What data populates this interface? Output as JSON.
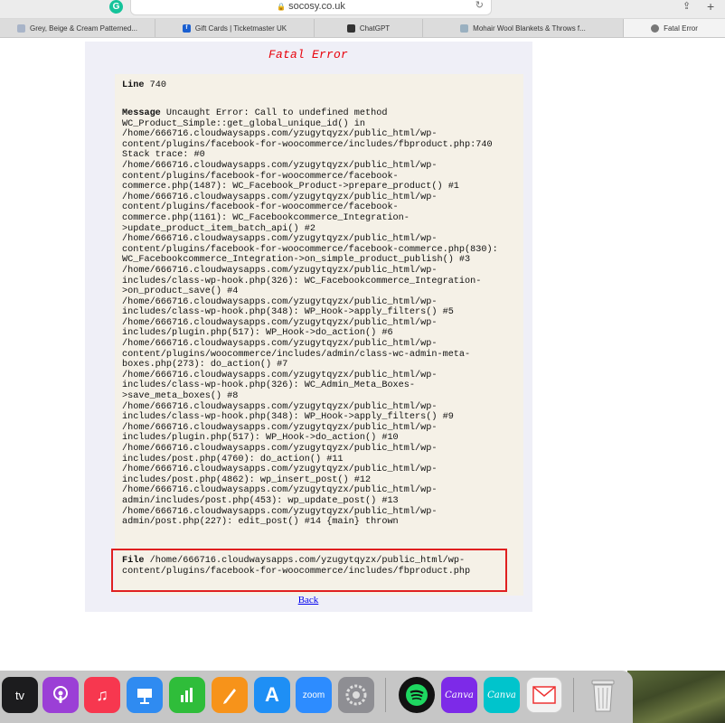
{
  "browser": {
    "url": "socosy.co.uk",
    "tabs": [
      {
        "label": "Grey, Beige & Cream Patterned...",
        "favicon_color": "#a8b4c8",
        "active": false
      },
      {
        "label": "Gift Cards | Ticketmaster UK",
        "favicon_color": "#1a5fd0",
        "favicon_glyph": "f",
        "active": false
      },
      {
        "label": "ChatGPT",
        "favicon_color": "#333333",
        "active": false
      },
      {
        "label": "Mohair Wool Blankets & Throws f...",
        "favicon_color": "#9ab0c0",
        "active": false
      },
      {
        "label": "Fatal Error",
        "favicon_color": "#777777",
        "active": true
      }
    ]
  },
  "page": {
    "title": "Fatal Error",
    "line_label": "Line",
    "line_value": "740",
    "message_label": "Message",
    "message_text": "Uncaught Error: Call to undefined method\nWC_Product_Simple::get_global_unique_id() in\n/home/666716.cloudwaysapps.com/yzugytqyzx/public_html/wp-\ncontent/plugins/facebook-for-woocommerce/includes/fbproduct.php:740\nStack trace: #0\n/home/666716.cloudwaysapps.com/yzugytqyzx/public_html/wp-\ncontent/plugins/facebook-for-woocommerce/facebook-\ncommerce.php(1487): WC_Facebook_Product->prepare_product() #1\n/home/666716.cloudwaysapps.com/yzugytqyzx/public_html/wp-\ncontent/plugins/facebook-for-woocommerce/facebook-\ncommerce.php(1161): WC_Facebookcommerce_Integration-\n>update_product_item_batch_api() #2\n/home/666716.cloudwaysapps.com/yzugytqyzx/public_html/wp-\ncontent/plugins/facebook-for-woocommerce/facebook-commerce.php(830):\nWC_Facebookcommerce_Integration->on_simple_product_publish() #3\n/home/666716.cloudwaysapps.com/yzugytqyzx/public_html/wp-\nincludes/class-wp-hook.php(326): WC_Facebookcommerce_Integration-\n>on_product_save() #4\n/home/666716.cloudwaysapps.com/yzugytqyzx/public_html/wp-\nincludes/class-wp-hook.php(348): WP_Hook->apply_filters() #5\n/home/666716.cloudwaysapps.com/yzugytqyzx/public_html/wp-\nincludes/plugin.php(517): WP_Hook->do_action() #6\n/home/666716.cloudwaysapps.com/yzugytqyzx/public_html/wp-\ncontent/plugins/woocommerce/includes/admin/class-wc-admin-meta-\nboxes.php(273): do_action() #7\n/home/666716.cloudwaysapps.com/yzugytqyzx/public_html/wp-\nincludes/class-wp-hook.php(326): WC_Admin_Meta_Boxes-\n>save_meta_boxes() #8\n/home/666716.cloudwaysapps.com/yzugytqyzx/public_html/wp-\nincludes/class-wp-hook.php(348): WP_Hook->apply_filters() #9\n/home/666716.cloudwaysapps.com/yzugytqyzx/public_html/wp-\nincludes/plugin.php(517): WP_Hook->do_action() #10\n/home/666716.cloudwaysapps.com/yzugytqyzx/public_html/wp-\nincludes/post.php(4760): do_action() #11\n/home/666716.cloudwaysapps.com/yzugytqyzx/public_html/wp-\nincludes/post.php(4862): wp_insert_post() #12\n/home/666716.cloudwaysapps.com/yzugytqyzx/public_html/wp-\nadmin/includes/post.php(453): wp_update_post() #13\n/home/666716.cloudwaysapps.com/yzugytqyzx/public_html/wp-\nadmin/post.php(227): edit_post() #14 {main} thrown",
    "file_label": "File",
    "file_text": "/home/666716.cloudwaysapps.com/yzugytqyzx/public_html/wp-\ncontent/plugins/facebook-for-woocommerce/includes/fbproduct.php",
    "back_link": "Back",
    "colors": {
      "title": "#e8000a",
      "highlight_border": "#e02020",
      "link": "#0000ee"
    }
  },
  "dock": {
    "apps": [
      {
        "name": "Apple TV",
        "label": "tv",
        "color": "#1c1c1e"
      },
      {
        "name": "Podcasts",
        "label": "",
        "color": "#9b3fd6"
      },
      {
        "name": "Music",
        "label": "♫",
        "color": "#f7374f"
      },
      {
        "name": "Keynote",
        "label": "",
        "color": "#2f8bf1"
      },
      {
        "name": "Numbers",
        "label": "",
        "color": "#2fbd3a"
      },
      {
        "name": "Pages",
        "label": "",
        "color": "#f7931a"
      },
      {
        "name": "App Store",
        "label": "",
        "color": "#1e8ff5"
      },
      {
        "name": "Zoom",
        "label": "zoom",
        "color": "#2d8cff"
      },
      {
        "name": "System Preferences",
        "label": "",
        "color": "#8e8e93"
      },
      {
        "name": "Spotify",
        "label": "",
        "color": "#121212"
      },
      {
        "name": "Canva",
        "label": "Canva",
        "color": "#7d2ae8"
      },
      {
        "name": "Canva",
        "label": "Canva",
        "color": "#00c4cc"
      },
      {
        "name": "Mail",
        "label": "",
        "color": "#f2f2f2"
      },
      {
        "name": "Trash",
        "label": "",
        "color": "#d0d0d0"
      }
    ]
  }
}
